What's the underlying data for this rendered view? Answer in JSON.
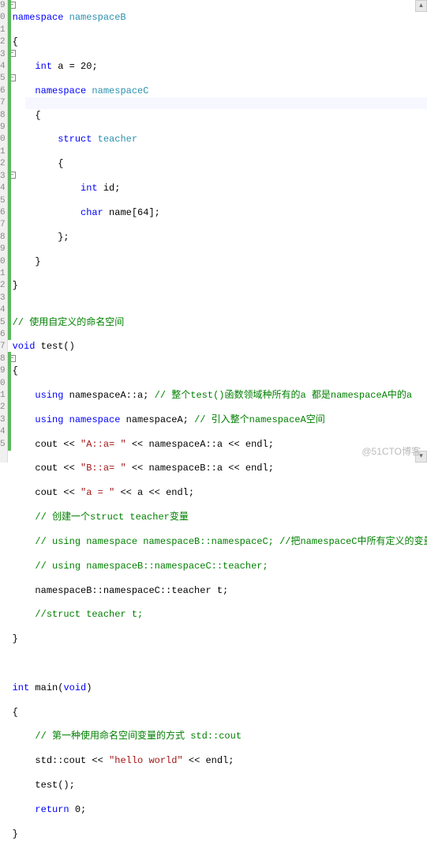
{
  "gutter": [
    "9",
    "0",
    "1",
    "2",
    "3",
    "4",
    "5",
    "6",
    "7",
    "8",
    "9",
    "0",
    "1",
    "2",
    "3",
    "4",
    "5",
    "6",
    "7",
    "8",
    "9",
    "0",
    "1",
    "2",
    "3",
    "4",
    "5",
    "6",
    "7",
    "8",
    "9",
    "0",
    "1",
    "2",
    "3",
    "4",
    "5"
  ],
  "lines": {
    "l1_kw1": "namespace",
    "l1_name": " namespaceB",
    "l2": "{",
    "l3_type": "int",
    "l3_rest": " a = 20;",
    "l4_kw": "namespace",
    "l4_name": " namespaceC",
    "l5": "{",
    "l6_kw": "struct",
    "l6_name": " teacher",
    "l7": "{",
    "l8_type": "int",
    "l8_rest": " id;",
    "l9_type": "char",
    "l9_rest": " name[64];",
    "l10": "};",
    "l11": "}",
    "l12": "}",
    "l13": "",
    "l14_cmt": "// 使用自定义的命名空间",
    "l15_type": "void",
    "l15_name": " test()",
    "l16": "{",
    "l17_kw1": "using",
    "l17_mid": " namespaceA::a; ",
    "l17_cmt": "// 整个test()函数领域种所有的a 都是namespaceA中的a",
    "l18_kw1": "using",
    "l18_kw2": " namespace",
    "l18_mid": " namespaceA; ",
    "l18_cmt": "// 引入整个namespaceA空间",
    "l19_a": "cout << ",
    "l19_str": "\"A::a= \"",
    "l19_b": " << namespaceA::a << ",
    "l19_endl": "endl",
    "l19_c": ";",
    "l20_a": "cout << ",
    "l20_str": "\"B::a= \"",
    "l20_b": " << namespaceB::a << ",
    "l20_endl": "endl",
    "l20_c": ";",
    "l21_a": "cout << ",
    "l21_str": "\"a = \"",
    "l21_b": " << a << ",
    "l21_endl": "endl",
    "l21_c": ";",
    "l22_cmt": "// 创建一个struct teacher变量",
    "l23_cmt": "// using namespace namespaceB::namespaceC; //把namespaceC中所有定义的变量都引入",
    "l24_cmt": "// using namespaceB::namespaceC::teacher;",
    "l25": "namespaceB::namespaceC::teacher t;",
    "l26_cmt": "//struct teacher t;",
    "l27": "}",
    "l28": "",
    "l29": "",
    "l30_type": "int",
    "l30_name": " main(",
    "l30_void": "void",
    "l30_close": ")",
    "l31": "{",
    "l32_cmt": "// 第一种使用命名空间变量的方式 std::cout",
    "l33_a": "std::cout << ",
    "l33_str": "\"hello world\"",
    "l33_b": " << ",
    "l33_endl": "endl",
    "l33_c": ";",
    "l34": "test();",
    "l35_kw": "return",
    "l35_rest": " 0;",
    "l36": "}"
  },
  "watermark": "@51CTO博客"
}
